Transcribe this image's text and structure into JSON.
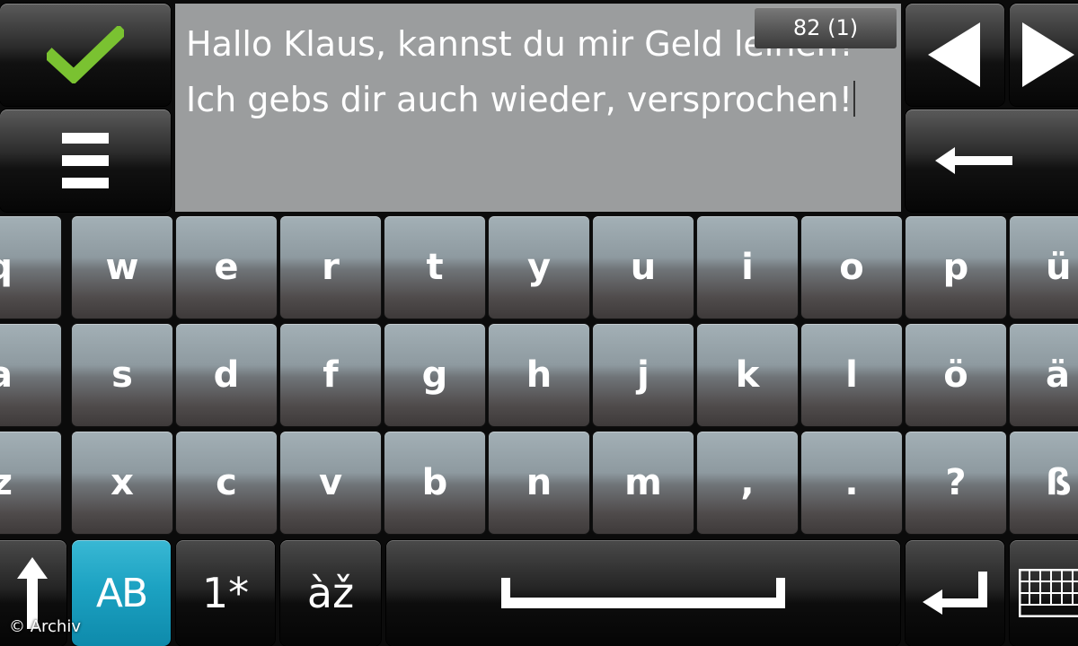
{
  "top": {
    "message_text": "Hallo Klaus, kannst du mir Geld leihen? Ich gebs dir auch wieder, versprochen!",
    "char_counter": "82 (1)"
  },
  "icons": {
    "confirm": "checkmark-icon",
    "menu": "hamburger-menu-icon",
    "prev": "arrow-left-icon",
    "next": "arrow-right-icon",
    "backspace": "backspace-arrow-icon",
    "shift": "shift-arrow-icon",
    "enter": "enter-icon",
    "hide_keyboard": "keyboard-icon"
  },
  "keyboard": {
    "rows": [
      [
        "q",
        "w",
        "e",
        "r",
        "t",
        "y",
        "u",
        "i",
        "o",
        "p",
        "ü"
      ],
      [
        "a",
        "s",
        "d",
        "f",
        "g",
        "h",
        "j",
        "k",
        "l",
        "ö",
        "ä"
      ],
      [
        "z",
        "x",
        "c",
        "v",
        "b",
        "n",
        "m",
        ",",
        ".",
        "?",
        "ß"
      ]
    ],
    "function_keys": {
      "case_mode": "AB",
      "numbers_symbols": "1*",
      "accents": "àž"
    }
  },
  "colors": {
    "accent_check": "#7ac231",
    "case_key_active": "#1ca2c2",
    "text_area_bg": "#9b9d9e"
  },
  "watermark": "© Archiv"
}
